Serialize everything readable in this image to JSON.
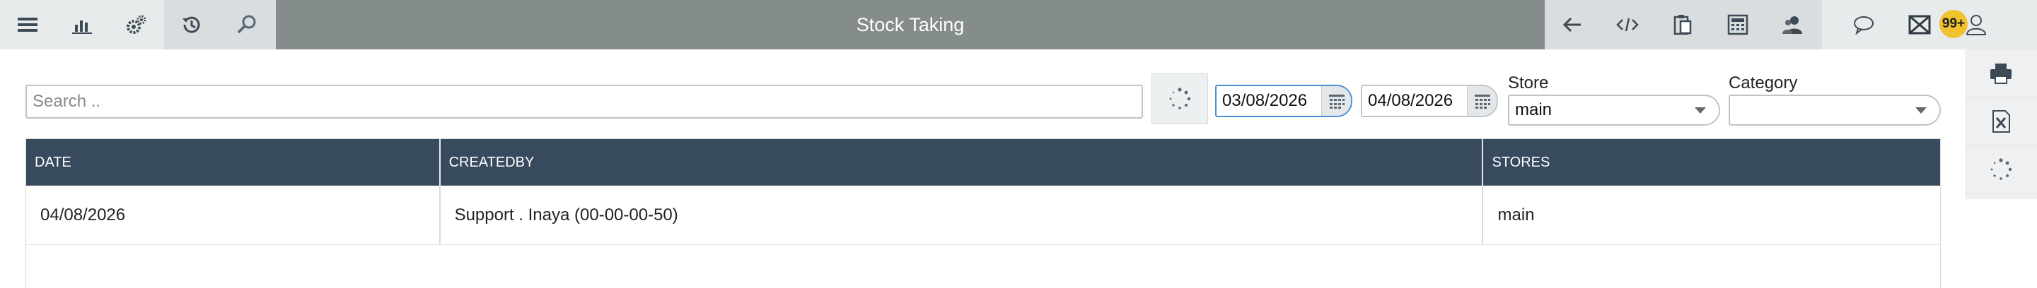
{
  "app": {
    "title": "Stock Taking"
  },
  "topbar": {
    "left_icons": [
      "menu-icon",
      "chart-icon",
      "gears-icon"
    ],
    "left_icons2": [
      "history-icon",
      "search-icon"
    ],
    "right_icons": [
      "arrow-left-icon",
      "code-icon",
      "clipboard-icon",
      "calculator-icon",
      "users-icon"
    ],
    "right_icons2": [
      "chat-icon",
      "mail-icon",
      "user-icon"
    ],
    "notification_badge": "99+"
  },
  "side_actions": [
    "print-icon",
    "excel-icon",
    "spinner-icon"
  ],
  "filters": {
    "search_placeholder": "Search ..",
    "date_from": "03/08/2026",
    "date_to": "04/08/2026",
    "store_label": "Store",
    "store_value": "main",
    "category_label": "Category",
    "category_value": ""
  },
  "table": {
    "columns": [
      "DATE",
      "CREATEDBY",
      "STORES"
    ],
    "rows": [
      {
        "date": "04/08/2026",
        "created_by": "Support . Inaya (00-00-00-50)",
        "stores": "main"
      }
    ]
  },
  "colors": {
    "title_bar": "#858c8c",
    "table_header": "#374a5e",
    "badge": "#f2c12e",
    "active_border": "#4a90d9"
  }
}
